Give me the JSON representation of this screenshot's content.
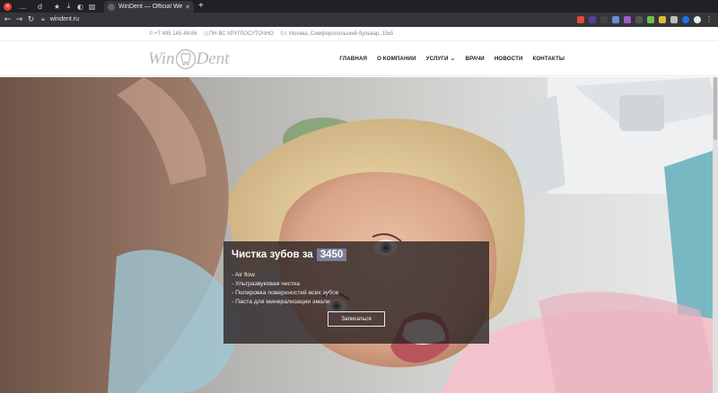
{
  "browser": {
    "tabs": [
      {
        "label": "..."
      },
      {
        "label": "d"
      }
    ],
    "active_tab": {
      "title": "WinDent — Official Website"
    },
    "url": "windent.ru",
    "accent_color": "#202124"
  },
  "site": {
    "info": {
      "phone": "+7 495 145-48-86",
      "hours": "ПН-ВС КРУГЛОСУТОЧНО",
      "address": "г. Москва, Симферопольский бульвар, 15к5"
    },
    "logo": {
      "left": "Win",
      "right": "Dent"
    },
    "menu": [
      {
        "label": "ГЛАВНАЯ"
      },
      {
        "label": "О КОМПАНИИ"
      },
      {
        "label": "УСЛУГИ"
      },
      {
        "label": "ВРАЧИ"
      },
      {
        "label": "НОВОСТИ"
      },
      {
        "label": "КОНТАКТЫ"
      }
    ],
    "promo": {
      "title": "Чистка зубов за",
      "price": "3450",
      "items": [
        "- Air flow",
        "- Ультразвуковая чистка",
        "- Полировка поверхностей всех зубов",
        "- Паста для минерализации эмали"
      ],
      "button": "Записаться"
    }
  }
}
